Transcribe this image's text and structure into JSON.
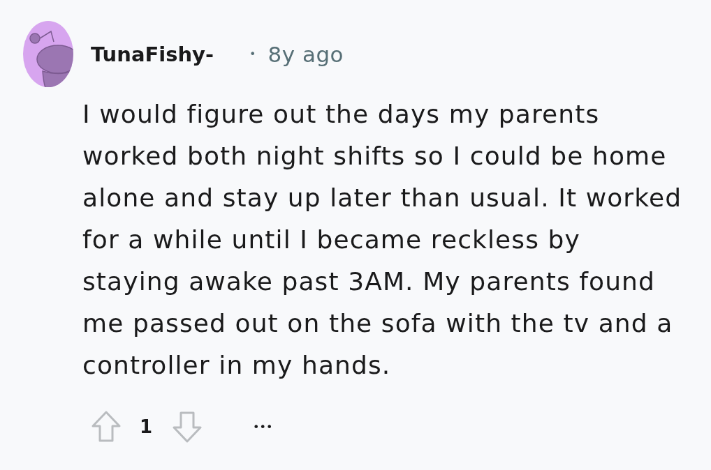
{
  "comment": {
    "author": "TunaFishy-",
    "separator": "•",
    "time": "8y ago",
    "body": "I would figure out the days my parents worked both night shifts so I could be home alone and stay up later than usual. It worked for a while until I became reckless by staying awake past 3AM. My parents found me passed out on the sofa with the tv and a controller in my hands.",
    "score": "1",
    "more": "•••"
  }
}
